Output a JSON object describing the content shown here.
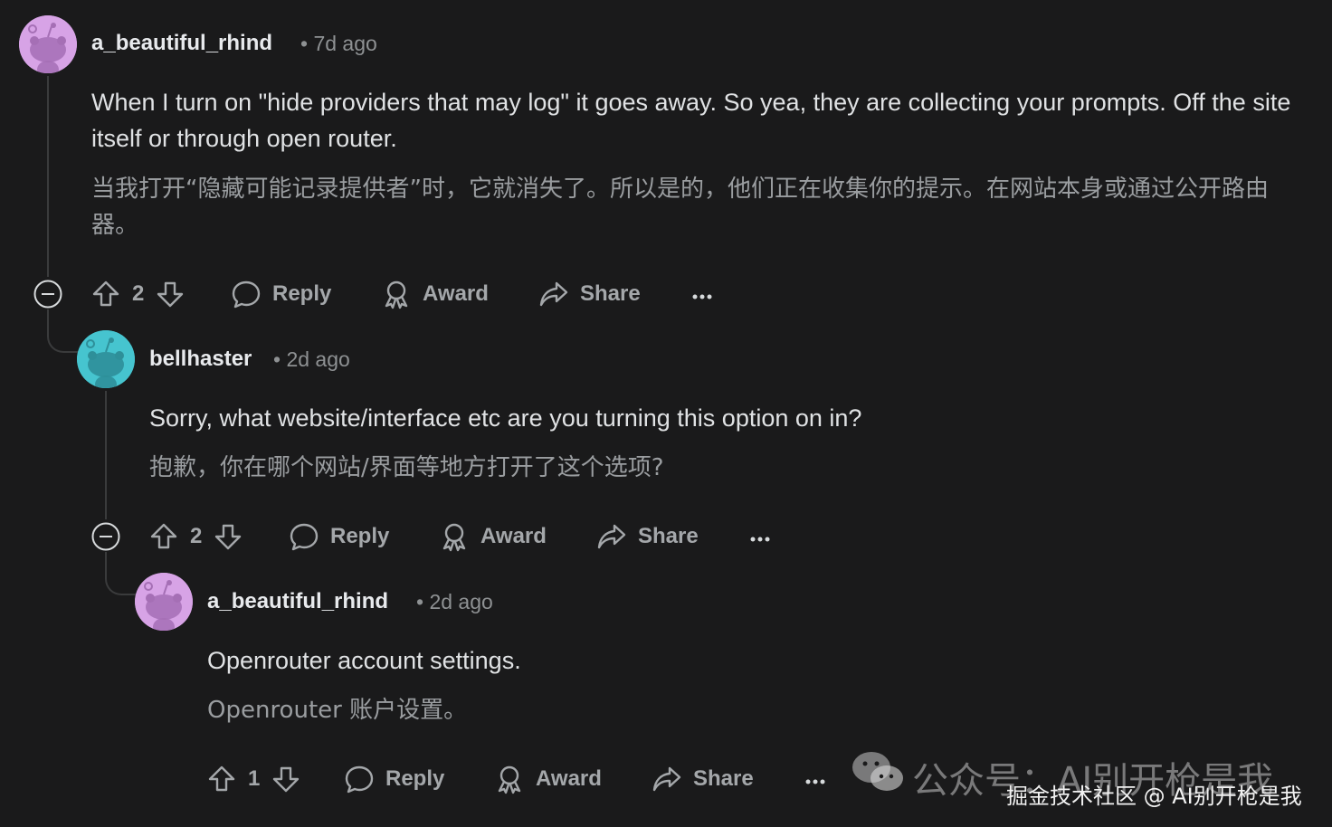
{
  "comments": [
    {
      "username": "a_beautiful_rhind",
      "time": "• 7d ago",
      "body_en": "When I turn on \"hide providers that may log\" it goes away. So yea, they are collecting your prompts. Off the site itself or through open router.",
      "body_zh": "当我打开“隐藏可能记录提供者”时，它就消失了。所以是的，他们正在收集你的提示。在网站本身或通过公开路由器。",
      "votes": "2",
      "avatar_color": "#d7a3e6"
    },
    {
      "username": "bellhaster",
      "time": "• 2d ago",
      "body_en": "Sorry, what website/interface etc are you turning this option on in?",
      "body_zh": "抱歉，你在哪个网站/界面等地方打开了这个选项?",
      "votes": "2",
      "avatar_color": "#46c4cf"
    },
    {
      "username": "a_beautiful_rhind",
      "time": "• 2d ago",
      "body_en": "Openrouter account settings.",
      "body_zh": "Openrouter 账户设置。",
      "votes": "1",
      "avatar_color": "#d7a3e6"
    }
  ],
  "actions": {
    "reply": "Reply",
    "award": "Award",
    "share": "Share"
  },
  "watermark": {
    "wechat": "公众号：AI别开枪是我",
    "juejin": "掘金技术社区 @ AI别开枪是我"
  },
  "colors": {
    "background": "#1a1a1b",
    "thread_line": "#3a3b3c",
    "muted": "#a4a7aa"
  },
  "icons": [
    "upvote-icon",
    "downvote-icon",
    "reply-bubble-icon",
    "award-icon",
    "share-icon",
    "more-icon",
    "collapse-icon",
    "wechat-icon"
  ]
}
